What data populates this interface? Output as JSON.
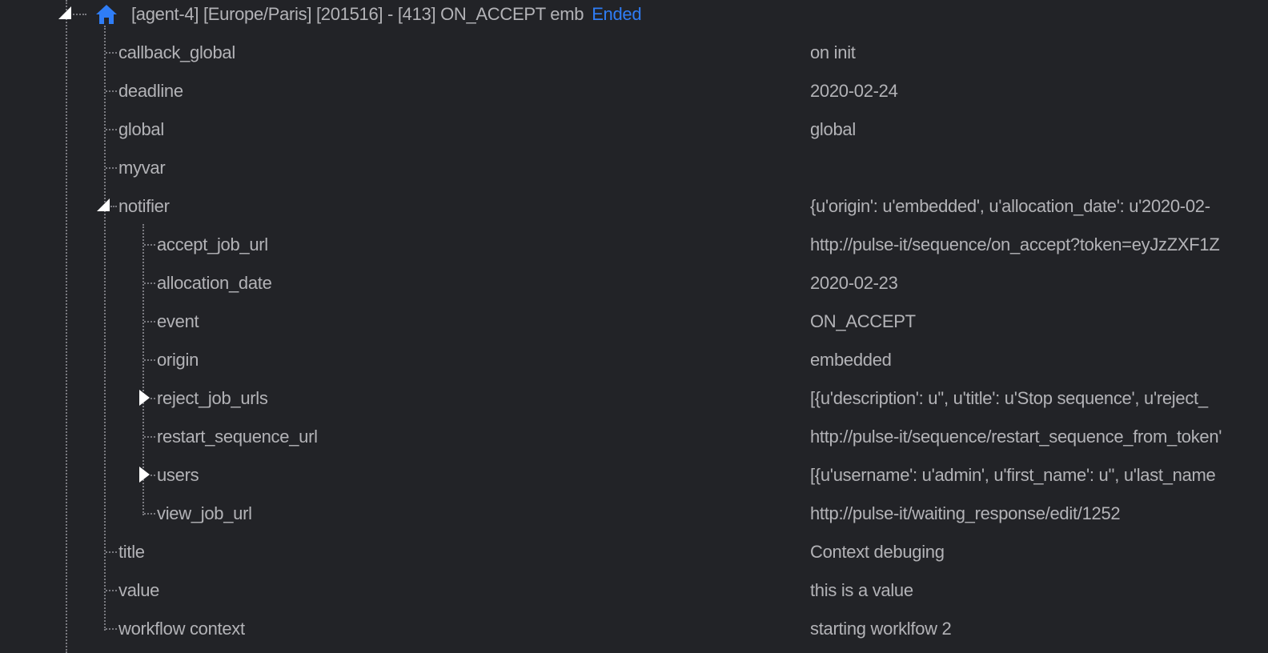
{
  "root": {
    "title": "[agent-4] [Europe/Paris] [201516] - [413] ON_ACCEPT emb",
    "status": "Ended",
    "status_color": "#2f7df6",
    "home_icon": "home-icon"
  },
  "rows": [
    {
      "key": "callback_global",
      "value": "on init"
    },
    {
      "key": "deadline",
      "value": "2020-02-24"
    },
    {
      "key": "global",
      "value": "global"
    },
    {
      "key": "myvar",
      "value": ""
    },
    {
      "key": "notifier",
      "value": "{u'origin': u'embedded', u'allocation_date': u'2020-02-",
      "state": "expanded"
    },
    {
      "key": "accept_job_url",
      "value": "http://pulse-it/sequence/on_accept?token=eyJzZXF1Z"
    },
    {
      "key": "allocation_date",
      "value": "2020-02-23"
    },
    {
      "key": "event",
      "value": "ON_ACCEPT"
    },
    {
      "key": "origin",
      "value": "embedded"
    },
    {
      "key": "reject_job_urls",
      "value": "[{u'description': u'', u'title': u'Stop sequence', u'reject_",
      "state": "collapsed"
    },
    {
      "key": "restart_sequence_url",
      "value": "http://pulse-it/sequence/restart_sequence_from_token'"
    },
    {
      "key": "users",
      "value": "[{u'username': u'admin', u'first_name': u'', u'last_name",
      "state": "collapsed"
    },
    {
      "key": "view_job_url",
      "value": "http://pulse-it/waiting_response/edit/1252"
    },
    {
      "key": "title",
      "value": "Context debuging"
    },
    {
      "key": "value",
      "value": "this is a value"
    },
    {
      "key": "workflow context",
      "value": "starting worklfow 2"
    }
  ]
}
